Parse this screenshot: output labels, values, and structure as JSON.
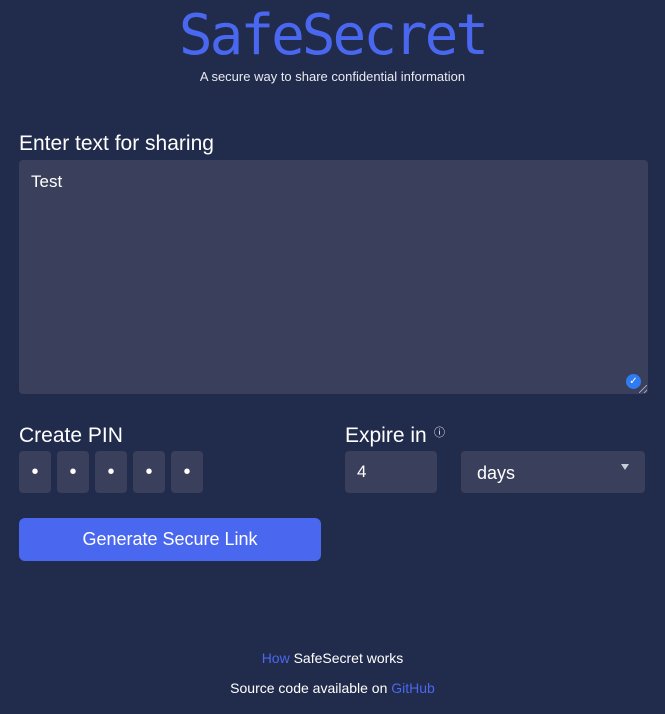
{
  "header": {
    "logo_text": "SafeSecret",
    "tagline": "A secure way to share confidential information"
  },
  "message": {
    "label": "Enter text for sharing",
    "value": "Test"
  },
  "pin": {
    "label": "Create PIN",
    "digits": [
      "•",
      "•",
      "•",
      "•",
      "•"
    ]
  },
  "expire": {
    "label": "Expire in",
    "info_icon": "ⓘ",
    "value": "4",
    "unit": "days"
  },
  "actions": {
    "generate_label": "Generate Secure Link"
  },
  "footer": {
    "how_link": "How",
    "how_text": " SafeSecret works",
    "source_text": "Source code available on ",
    "github_link": "GitHub"
  },
  "colors": {
    "background": "#212b4b",
    "accent": "#4a67f0",
    "field": "#3a3f5c"
  }
}
